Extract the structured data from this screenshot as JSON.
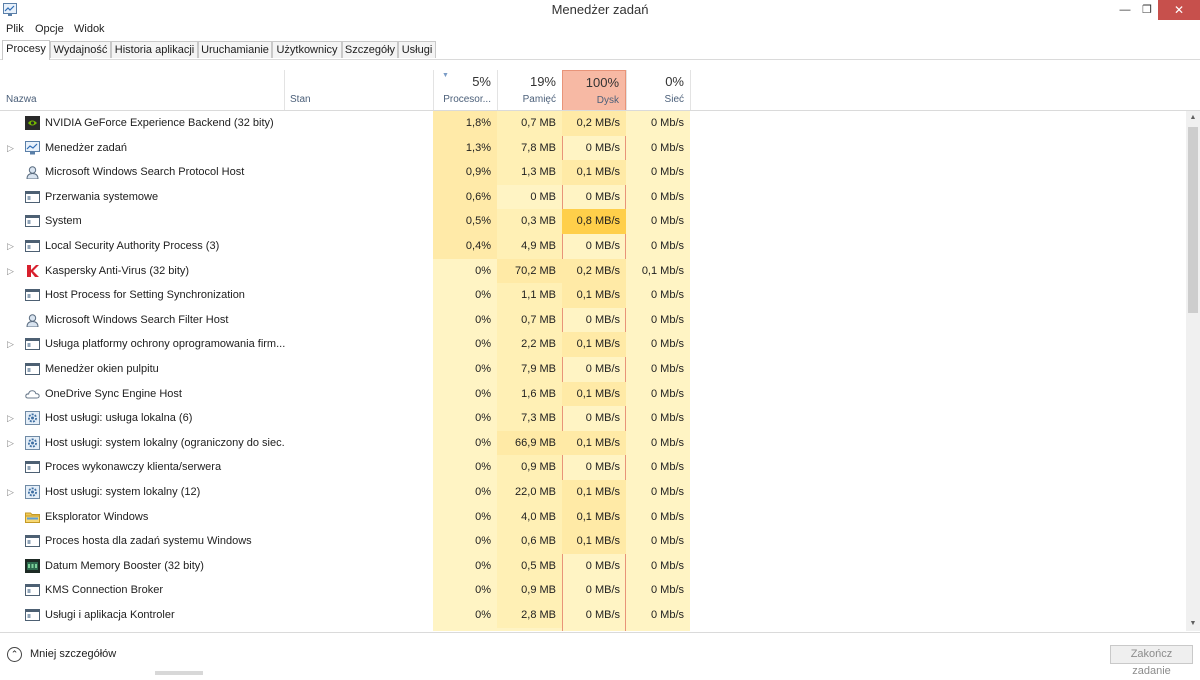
{
  "window": {
    "title": "Menedżer zadań",
    "minimize": "—",
    "maximize": "❐",
    "close": "✕"
  },
  "menu": [
    "Plik",
    "Opcje",
    "Widok"
  ],
  "tabs": [
    "Procesy",
    "Wydajność",
    "Historia aplikacji",
    "Uruchamianie",
    "Użytkownicy",
    "Szczegóły",
    "Usługi"
  ],
  "active_tab": "Procesy",
  "columns": {
    "name": "Nazwa",
    "status": "Stan",
    "cpu": {
      "label": "Procesor...",
      "pct": "5%"
    },
    "mem": {
      "label": "Pamięć",
      "pct": "19%"
    },
    "disk": {
      "label": "Dysk",
      "pct": "100%"
    },
    "net": {
      "label": "Sieć",
      "pct": "0%"
    }
  },
  "colors": {
    "cpu_col": "#fff4c4",
    "mem_col": "#fff4c4",
    "disk_col": "#fff4c4",
    "net_col": "#fff4c4",
    "cell_light": "#fff4c4",
    "cell_mid": "#ffeaa6",
    "cell_hot": "#ffcf4a",
    "disk_header": "#f7b9a4",
    "disk_header_border": "#e89479"
  },
  "processes": [
    {
      "name": "NVIDIA GeForce Experience Backend (32 bity)",
      "icon": "nvidia-icon",
      "expand": false,
      "cpu": "1,8%",
      "mem": "0,7 MB",
      "disk": "0,2 MB/s",
      "net": "0 Mb/s",
      "h": [
        2,
        1,
        2,
        0
      ]
    },
    {
      "name": "Menedżer zadań",
      "icon": "task-manager-icon",
      "expand": true,
      "cpu": "1,3%",
      "mem": "7,8 MB",
      "disk": "0 MB/s",
      "net": "0 Mb/s",
      "h": [
        2,
        1,
        0,
        0
      ]
    },
    {
      "name": "Microsoft Windows Search Protocol Host",
      "icon": "search-protocol-icon",
      "expand": false,
      "cpu": "0,9%",
      "mem": "1,3 MB",
      "disk": "0,1 MB/s",
      "net": "0 Mb/s",
      "h": [
        2,
        1,
        1,
        0
      ]
    },
    {
      "name": "Przerwania systemowe",
      "icon": "system-window-icon",
      "expand": false,
      "cpu": "0,6%",
      "mem": "0 MB",
      "disk": "0 MB/s",
      "net": "0 Mb/s",
      "h": [
        2,
        0,
        0,
        0
      ]
    },
    {
      "name": "System",
      "icon": "system-window-icon",
      "expand": false,
      "cpu": "0,5%",
      "mem": "0,3 MB",
      "disk": "0,8 MB/s",
      "net": "0 Mb/s",
      "h": [
        2,
        1,
        3,
        0
      ]
    },
    {
      "name": "Local Security Authority Process (3)",
      "icon": "system-window-icon",
      "expand": true,
      "cpu": "0,4%",
      "mem": "4,9 MB",
      "disk": "0 MB/s",
      "net": "0 Mb/s",
      "h": [
        2,
        1,
        0,
        0
      ]
    },
    {
      "name": "Kaspersky Anti-Virus (32 bity)",
      "icon": "kaspersky-icon",
      "expand": true,
      "cpu": "0%",
      "mem": "70,2 MB",
      "disk": "0,2 MB/s",
      "net": "0,1 Mb/s",
      "h": [
        0,
        2,
        2,
        1
      ]
    },
    {
      "name": "Host Process for Setting Synchronization",
      "icon": "system-window-icon",
      "expand": false,
      "cpu": "0%",
      "mem": "1,1 MB",
      "disk": "0,1 MB/s",
      "net": "0 Mb/s",
      "h": [
        0,
        1,
        1,
        0
      ]
    },
    {
      "name": "Microsoft Windows Search Filter Host",
      "icon": "search-filter-icon",
      "expand": false,
      "cpu": "0%",
      "mem": "0,7 MB",
      "disk": "0 MB/s",
      "net": "0 Mb/s",
      "h": [
        0,
        1,
        0,
        0
      ]
    },
    {
      "name": "Usługa platformy ochrony oprogramowania firm...",
      "icon": "system-window-icon",
      "expand": true,
      "cpu": "0%",
      "mem": "2,2 MB",
      "disk": "0,1 MB/s",
      "net": "0 Mb/s",
      "h": [
        0,
        1,
        1,
        0
      ]
    },
    {
      "name": "Menedżer okien pulpitu",
      "icon": "system-window-icon",
      "expand": false,
      "cpu": "0%",
      "mem": "7,9 MB",
      "disk": "0 MB/s",
      "net": "0 Mb/s",
      "h": [
        0,
        1,
        0,
        0
      ]
    },
    {
      "name": "OneDrive Sync Engine Host",
      "icon": "onedrive-icon",
      "expand": false,
      "cpu": "0%",
      "mem": "1,6 MB",
      "disk": "0,1 MB/s",
      "net": "0 Mb/s",
      "h": [
        0,
        1,
        1,
        0
      ]
    },
    {
      "name": "Host usługi: usługa lokalna (6)",
      "icon": "service-gear-icon",
      "expand": true,
      "cpu": "0%",
      "mem": "7,3 MB",
      "disk": "0 MB/s",
      "net": "0 Mb/s",
      "h": [
        0,
        1,
        0,
        0
      ]
    },
    {
      "name": "Host usługi: system lokalny (ograniczony do siec...",
      "icon": "service-gear-icon",
      "expand": true,
      "cpu": "0%",
      "mem": "66,9 MB",
      "disk": "0,1 MB/s",
      "net": "0 Mb/s",
      "h": [
        0,
        2,
        1,
        0
      ]
    },
    {
      "name": "Proces wykonawczy klienta/serwera",
      "icon": "system-window-icon",
      "expand": false,
      "cpu": "0%",
      "mem": "0,9 MB",
      "disk": "0 MB/s",
      "net": "0 Mb/s",
      "h": [
        0,
        1,
        0,
        0
      ]
    },
    {
      "name": "Host usługi: system lokalny (12)",
      "icon": "service-gear-icon",
      "expand": true,
      "cpu": "0%",
      "mem": "22,0 MB",
      "disk": "0,1 MB/s",
      "net": "0 Mb/s",
      "h": [
        0,
        1,
        1,
        0
      ]
    },
    {
      "name": "Eksplorator Windows",
      "icon": "folder-icon",
      "expand": false,
      "cpu": "0%",
      "mem": "4,0 MB",
      "disk": "0,1 MB/s",
      "net": "0 Mb/s",
      "h": [
        0,
        1,
        1,
        0
      ]
    },
    {
      "name": "Proces hosta dla zadań systemu Windows",
      "icon": "system-window-icon",
      "expand": false,
      "cpu": "0%",
      "mem": "0,6 MB",
      "disk": "0,1 MB/s",
      "net": "0 Mb/s",
      "h": [
        0,
        1,
        1,
        0
      ]
    },
    {
      "name": "Datum Memory Booster (32 bity)",
      "icon": "memory-booster-icon",
      "expand": false,
      "cpu": "0%",
      "mem": "0,5 MB",
      "disk": "0 MB/s",
      "net": "0 Mb/s",
      "h": [
        0,
        1,
        0,
        0
      ]
    },
    {
      "name": "KMS Connection Broker",
      "icon": "system-window-icon",
      "expand": false,
      "cpu": "0%",
      "mem": "0,9 MB",
      "disk": "0 MB/s",
      "net": "0 Mb/s",
      "h": [
        0,
        1,
        0,
        0
      ]
    },
    {
      "name": "Usługi i aplikacja Kontroler",
      "icon": "system-window-icon",
      "expand": false,
      "cpu": "0%",
      "mem": "2,8 MB",
      "disk": "0 MB/s",
      "net": "0 Mb/s",
      "h": [
        0,
        1,
        0,
        0
      ]
    }
  ],
  "footer": {
    "fewer_details": "Mniej szczegółów",
    "end_task": "Zakończ zadanie"
  }
}
